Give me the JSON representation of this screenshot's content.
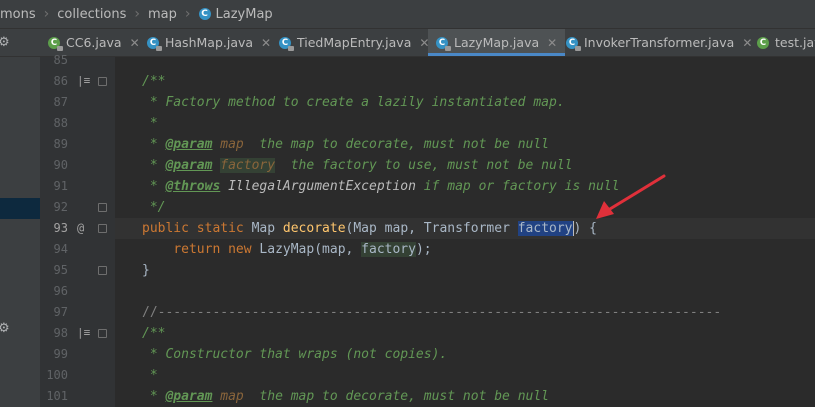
{
  "breadcrumb": {
    "items": [
      "mons",
      "collections",
      "map"
    ],
    "current_icon": "C",
    "current": "LazyMap"
  },
  "tabs": [
    {
      "label": "CC6.java",
      "icon": "C",
      "icon_color": "green",
      "active": false
    },
    {
      "label": "HashMap.java",
      "icon": "C",
      "icon_color": "blue",
      "active": false
    },
    {
      "label": "TiedMapEntry.java",
      "icon": "C",
      "icon_color": "blue",
      "active": false
    },
    {
      "label": "LazyMap.java",
      "icon": "C",
      "icon_color": "blue",
      "active": true
    },
    {
      "label": "InvokerTransformer.java",
      "icon": "C",
      "icon_color": "blue",
      "active": false
    },
    {
      "label": "test.java",
      "icon": "C",
      "icon_color": "green",
      "active": false
    }
  ],
  "editor": {
    "line_numbers": [
      "85",
      "86",
      "87",
      "88",
      "89",
      "90",
      "91",
      "92",
      "93",
      "94",
      "95",
      "96",
      "97",
      "98",
      "99",
      "100",
      "101"
    ],
    "current_line": "93",
    "override_marker": "@",
    "lines": {
      "l86": "/**",
      "l87": " * Factory method to create a lazily instantiated map.",
      "l88": " *",
      "l89_a": " * ",
      "l89_tag": "@param",
      "l89_sp": " ",
      "l89_name": "map",
      "l89_rest": "  the map to decorate, must not be null",
      "l90_a": " * ",
      "l90_tag": "@param",
      "l90_sp": " ",
      "l90_name": "factory",
      "l90_rest": "  the factory to use, must not be null",
      "l91_a": " * ",
      "l91_tag": "@throws",
      "l91_sp": " ",
      "l91_ref": "IllegalArgumentException",
      "l91_rest": " if map or factory is null",
      "l92": " */",
      "l93_kw1": "public",
      "l93_kw2": "static",
      "l93_type": "Map",
      "l93_fn": "decorate",
      "l93_args1": "(Map map, Transformer ",
      "l93_sel": "factory",
      "l93_end": ") {",
      "l94_kw1": "return",
      "l94_kw2": "new",
      "l94_mid": "LazyMap(map, ",
      "l94_use": "factory",
      "l94_end": ");",
      "l95": "}",
      "l97": "//------------------------------------------------------------------------",
      "l98": "/**",
      "l99": " * Constructor that wraps (not copies).",
      "l100": " *",
      "l101_a": " * ",
      "l101_tag": "@param",
      "l101_sp": " ",
      "l101_name": "map",
      "l101_rest": "  the map to decorate, must not be null"
    }
  },
  "colors": {
    "background": "#2b2b2b",
    "keyword": "#cc7832",
    "method": "#ffc66d",
    "doc_comment": "#629755",
    "selection": "#214283",
    "annotation_arrow": "#e0303a"
  }
}
